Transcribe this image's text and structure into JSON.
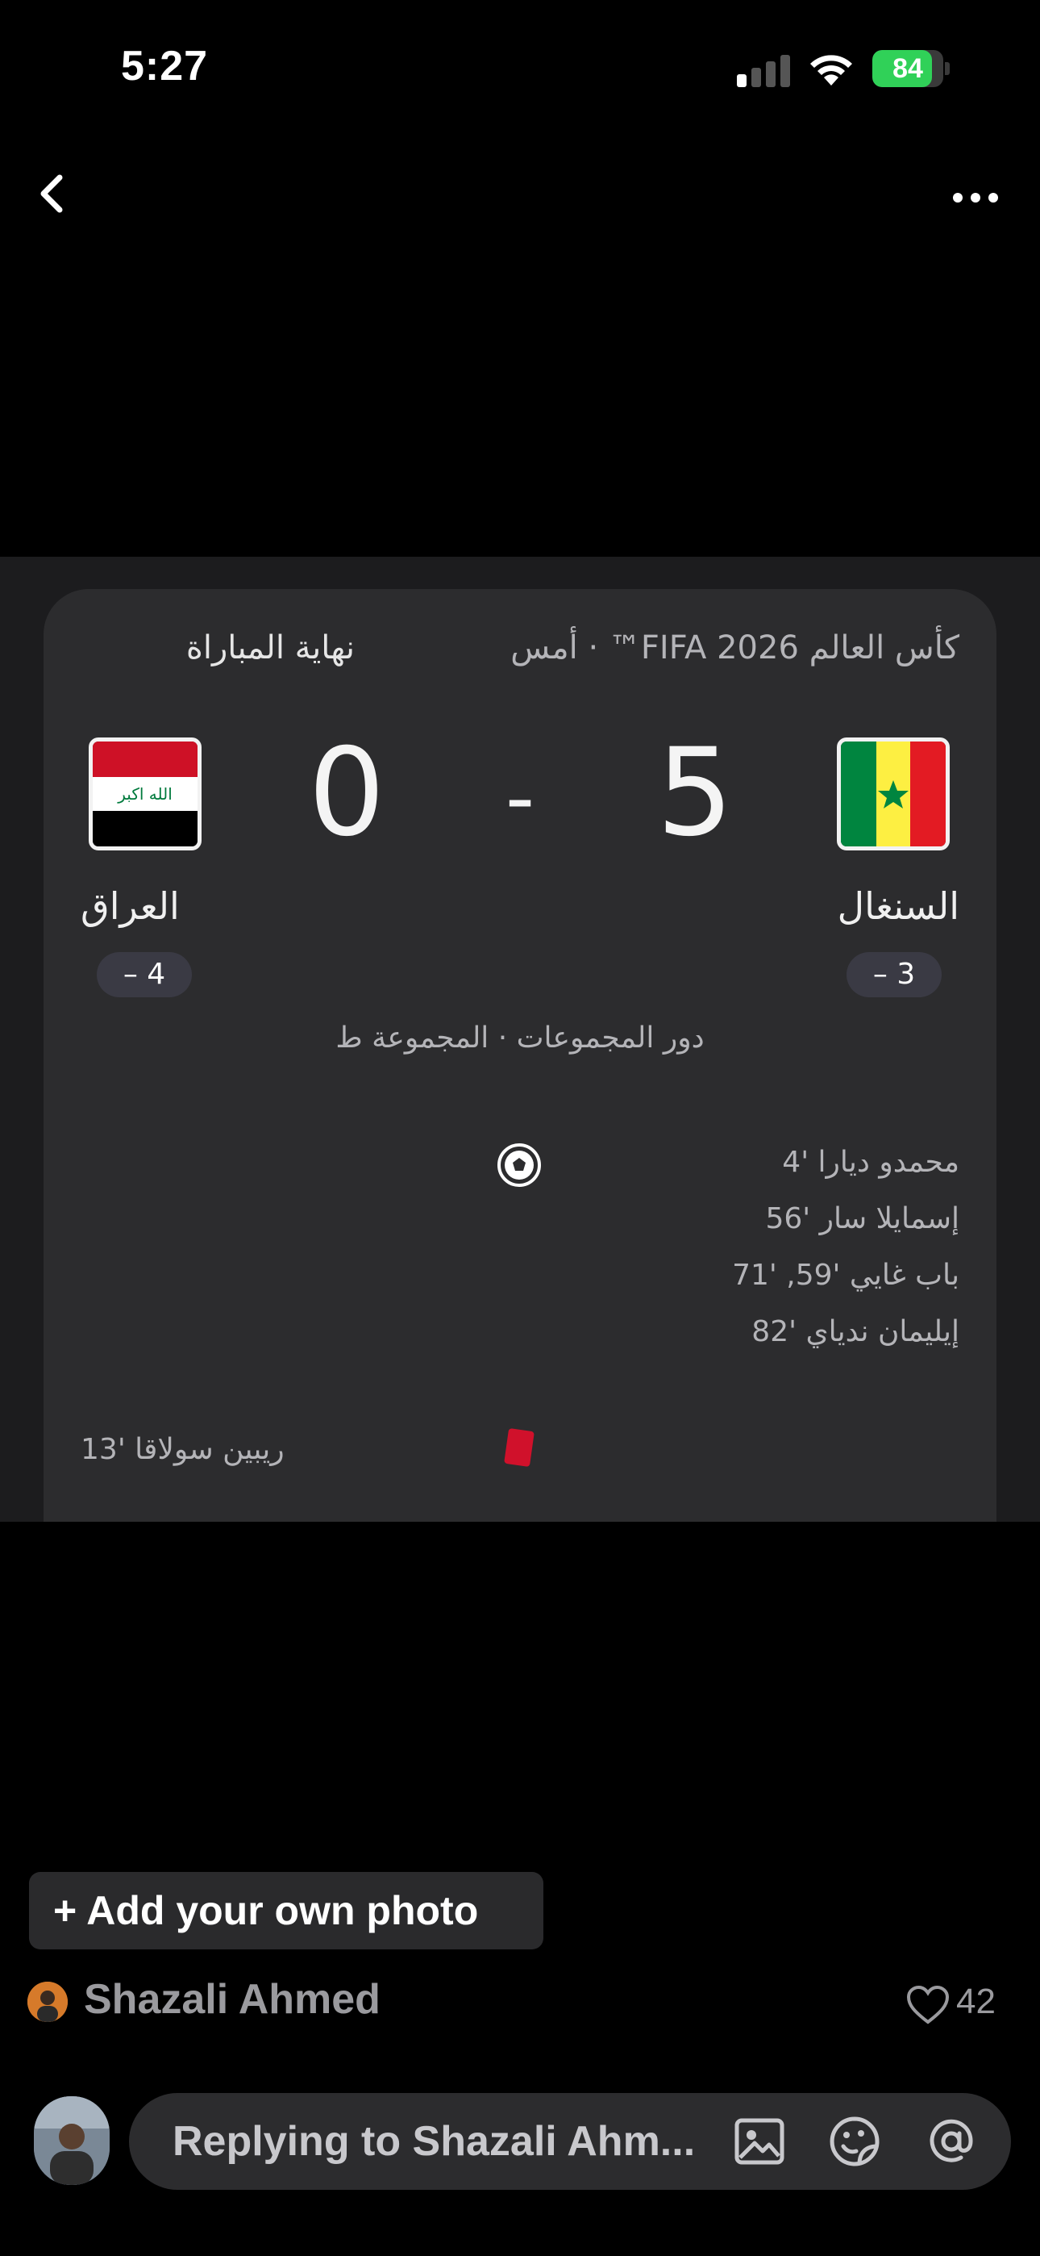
{
  "status_bar": {
    "time": "5:27",
    "battery_percent": "84",
    "battery_level": 0.84,
    "signal_bars_active": 1
  },
  "nav": {
    "back_icon": "chevron-left-icon",
    "more_icon": "ellipsis-icon"
  },
  "match": {
    "status": "نهاية المباراة",
    "competition": "كأس العالم FIFA 2026™ · أمس",
    "round": "دور المجموعات · المجموعة ط",
    "home": {
      "name": "العراق",
      "score": "0",
      "position_pill": "– 4",
      "flag": "iraq"
    },
    "away": {
      "name": "السنغال",
      "score": "5",
      "position_pill": "– 3",
      "flag": "senegal"
    },
    "separator": "-",
    "goals_away": [
      "محمدو ديارا '4",
      "إسمايلا سار '56",
      "باب غايي '59, '71",
      "إيليمان ندياي '82"
    ],
    "red_cards_home": [
      "ريبين سولاقا '13"
    ],
    "colors": {
      "red_card": "#d0112b",
      "card_bg": "#2c2c2e"
    }
  },
  "post": {
    "add_photo_label": "+ Add your own photo",
    "author": "Shazali Ahmed",
    "likes": "42"
  },
  "reply": {
    "placeholder": "Replying to Shazali Ahmed",
    "display": "Replying to Shazali Ahm..."
  }
}
